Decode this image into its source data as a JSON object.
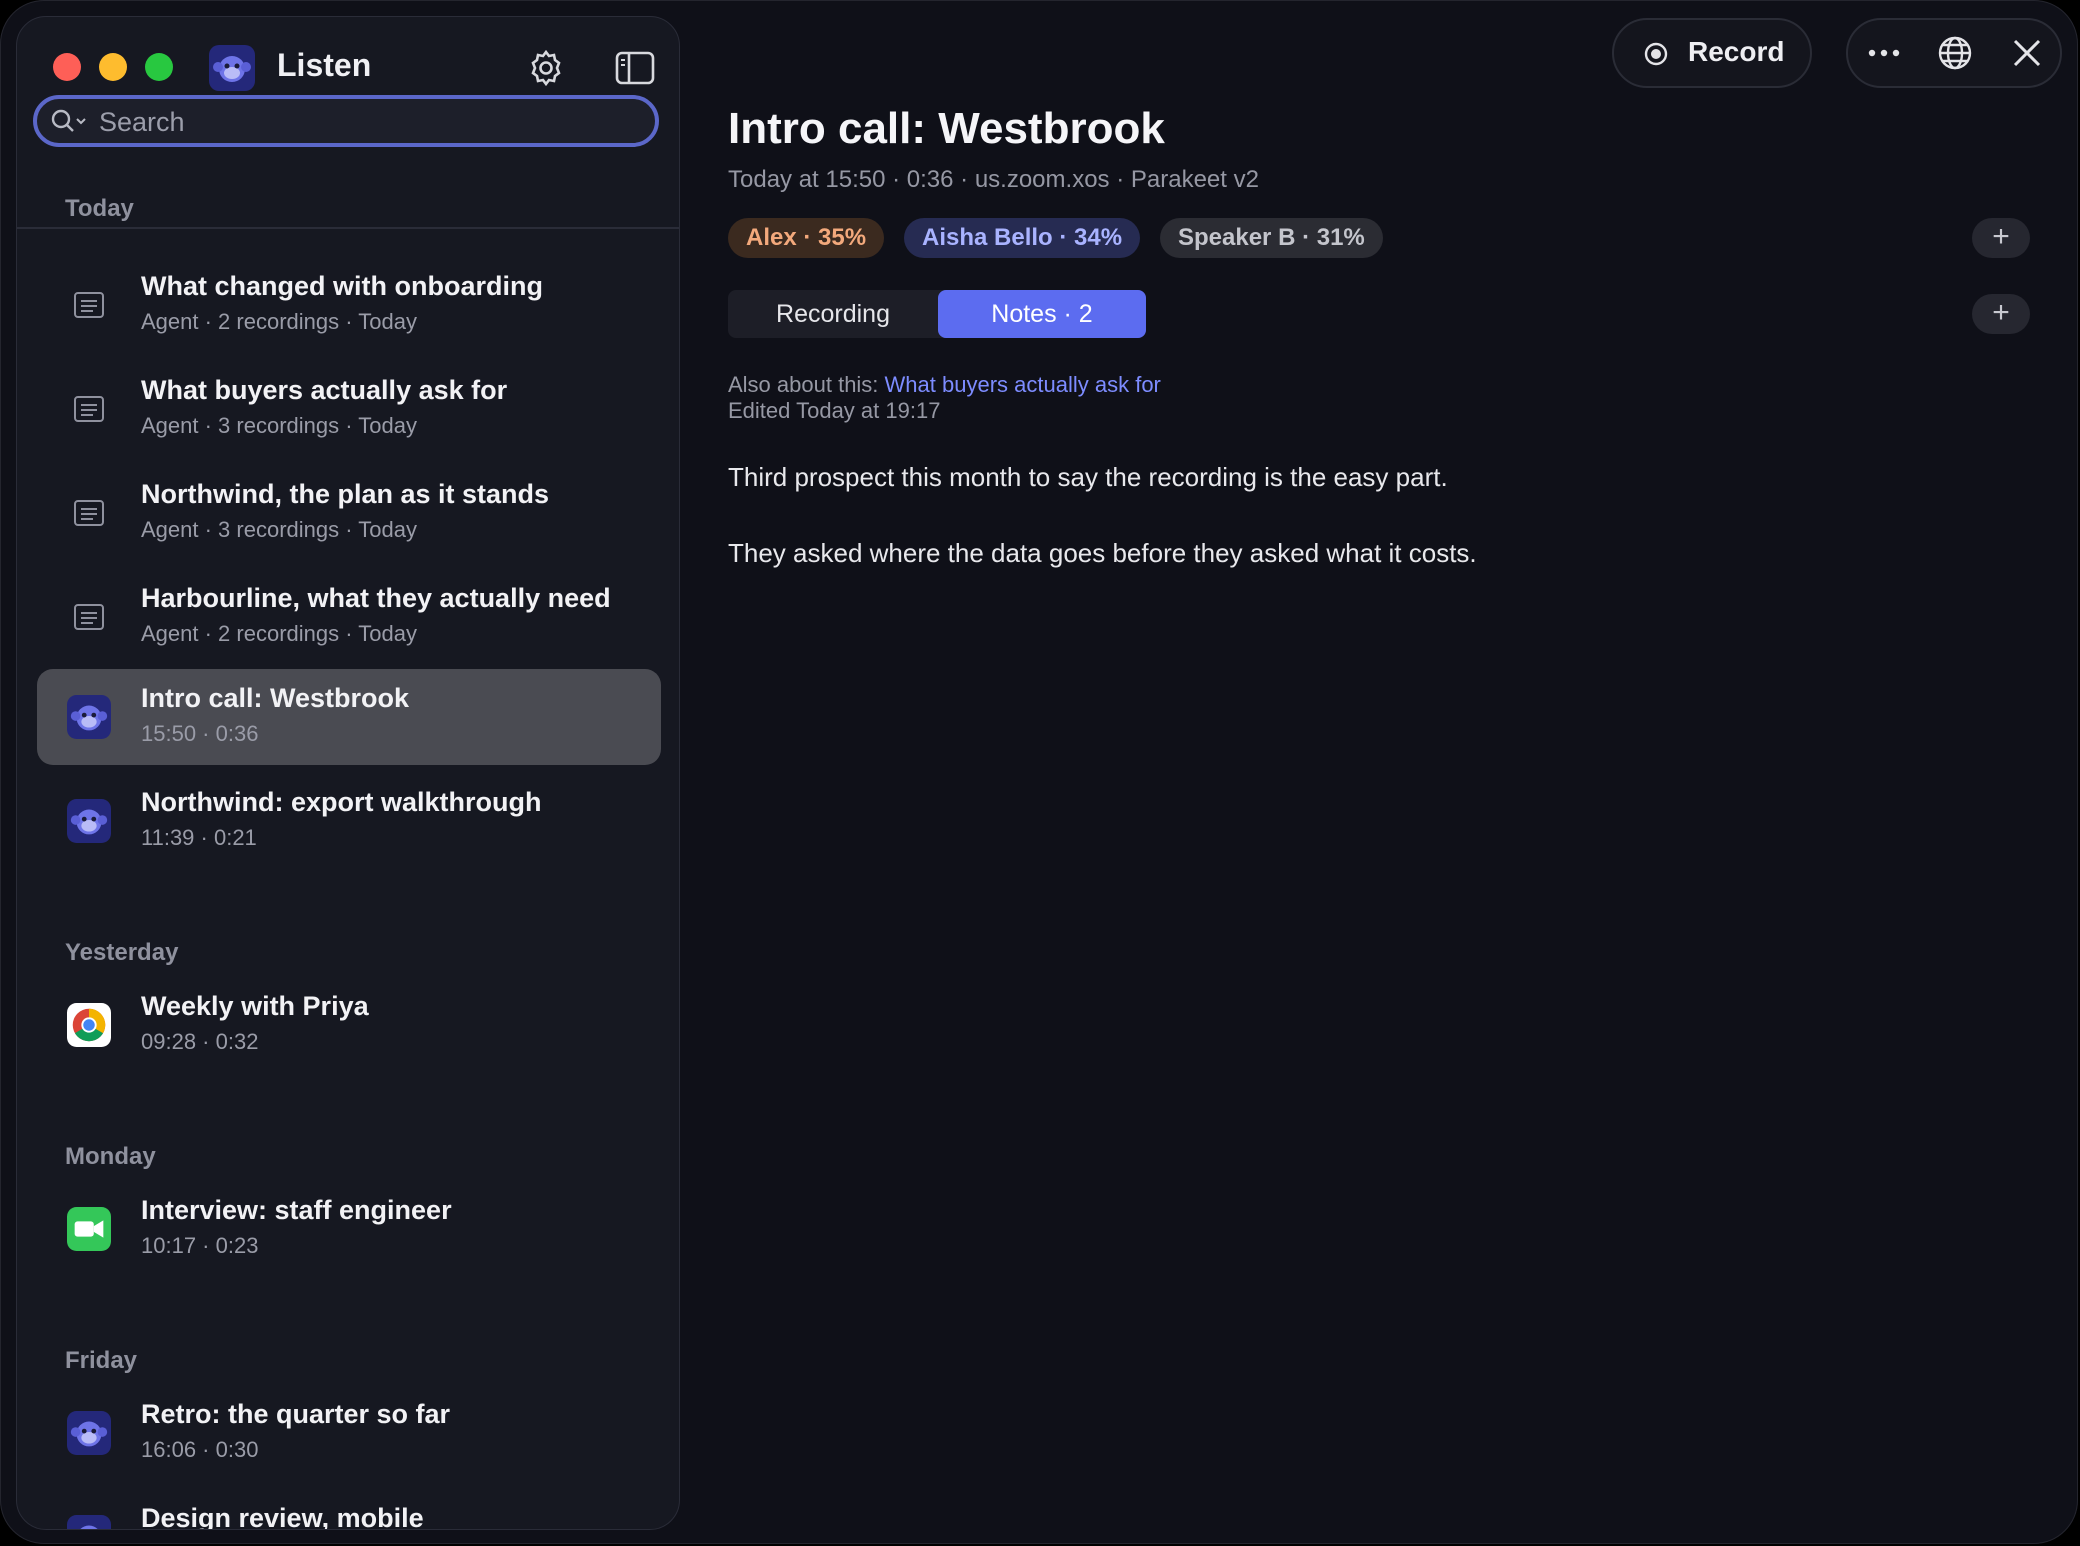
{
  "app": {
    "title": "Listen"
  },
  "search": {
    "placeholder": "Search"
  },
  "sections": [
    {
      "label": "Today",
      "items": [
        {
          "title": "What changed with onboarding",
          "sub": "Agent · 2 recordings · Today",
          "icon": "document-icon"
        },
        {
          "title": "What buyers actually ask for",
          "sub": "Agent · 3 recordings · Today",
          "icon": "document-icon"
        },
        {
          "title": "Northwind, the plan as it stands",
          "sub": "Agent · 3 recordings · Today",
          "icon": "document-icon"
        },
        {
          "title": "Harbourline, what they actually need",
          "sub": "Agent · 2 recordings · Today",
          "icon": "document-icon"
        },
        {
          "title": "Intro call: Westbrook",
          "sub": "15:50 · 0:36",
          "icon": "listen-app-icon",
          "selected": true
        },
        {
          "title": "Northwind: export walkthrough",
          "sub": "11:39 · 0:21",
          "icon": "listen-app-icon"
        }
      ]
    },
    {
      "label": "Yesterday",
      "items": [
        {
          "title": "Weekly with Priya",
          "sub": "09:28 · 0:32",
          "icon": "chrome-icon"
        }
      ]
    },
    {
      "label": "Monday",
      "items": [
        {
          "title": "Interview: staff engineer",
          "sub": "10:17 · 0:23",
          "icon": "facetime-icon"
        }
      ]
    },
    {
      "label": "Friday",
      "items": [
        {
          "title": "Retro: the quarter so far",
          "sub": "16:06 · 0:30",
          "icon": "listen-app-icon"
        },
        {
          "title": "Design review, mobile",
          "sub": "",
          "icon": "listen-app-icon"
        }
      ]
    }
  ],
  "toolbar": {
    "record_label": "Record"
  },
  "detail": {
    "title": "Intro call: Westbrook",
    "meta": "Today at 15:50 · 0:36 · us.zoom.xos · Parakeet v2",
    "speakers": [
      {
        "label": "Alex · 35%",
        "color": "#f3a97c"
      },
      {
        "label": "Aisha Bello · 34%",
        "color": "#a9b3ff"
      },
      {
        "label": "Speaker B · 31%",
        "color": "#c4c5cc"
      }
    ],
    "plus": "+",
    "tabs": [
      {
        "label": "Recording",
        "active": false
      },
      {
        "label": "Notes · 2",
        "active": true
      }
    ],
    "also_prefix": "Also about this: ",
    "also_link": "What buyers actually ask for",
    "edited": "Edited Today at 19:17",
    "paragraphs": [
      "Third prospect this month to say the recording is the easy part.",
      "They asked where the data goes before they asked what it costs."
    ]
  },
  "colors": {
    "accent": "#5c6cf0",
    "link": "#7d8cff",
    "search_border": "#5b67c9"
  }
}
